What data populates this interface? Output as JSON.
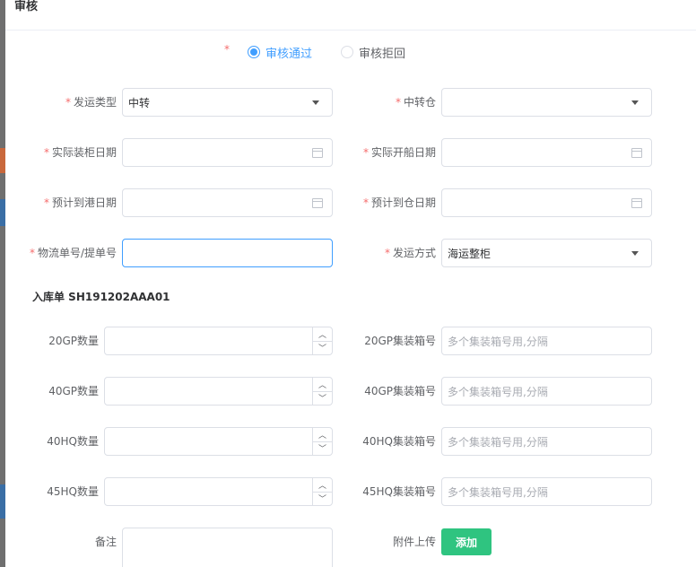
{
  "dialog": {
    "title": "审核"
  },
  "required_mark": "*",
  "review": {
    "options": [
      {
        "label": "审核通过",
        "selected": true
      },
      {
        "label": "审核拒回",
        "selected": false
      }
    ]
  },
  "shipping": {
    "ship_type": {
      "label": "发运类型",
      "value": "中转"
    },
    "transit_warehouse": {
      "label": "中转仓",
      "value": ""
    },
    "actual_loading_date": {
      "label": "实际装柜日期",
      "value": ""
    },
    "actual_sailing_date": {
      "label": "实际开船日期",
      "value": ""
    },
    "eta_port_date": {
      "label": "预计到港日期",
      "value": ""
    },
    "eta_warehouse_date": {
      "label": "预计到仓日期",
      "value": ""
    },
    "tracking_no": {
      "label": "物流单号/提单号",
      "value": ""
    },
    "ship_method": {
      "label": "发运方式",
      "value": "海运整柜"
    }
  },
  "inbound": {
    "title": "入库单 SH191202AAA01",
    "containers": [
      {
        "qty_label": "20GP数量",
        "no_label": "20GP集装箱号",
        "qty": "",
        "no_placeholder": "多个集装箱号用,分隔"
      },
      {
        "qty_label": "40GP数量",
        "no_label": "40GP集装箱号",
        "qty": "",
        "no_placeholder": "多个集装箱号用,分隔"
      },
      {
        "qty_label": "40HQ数量",
        "no_label": "40HQ集装箱号",
        "qty": "",
        "no_placeholder": "多个集装箱号用,分隔"
      },
      {
        "qty_label": "45HQ数量",
        "no_label": "45HQ集装箱号",
        "qty": "",
        "no_placeholder": "多个集装箱号用,分隔"
      }
    ]
  },
  "remarks": {
    "label": "备注",
    "value": ""
  },
  "attachment": {
    "label": "附件上传",
    "button": "添加"
  },
  "stepper": {
    "up": "︿",
    "down": "﹀"
  },
  "icons": {
    "calendar": "calendar-icon",
    "dropdown": "chevron-down-icon"
  },
  "colors": {
    "primary": "#409eff",
    "required": "#f56c6c",
    "add_button": "#2fc480"
  }
}
